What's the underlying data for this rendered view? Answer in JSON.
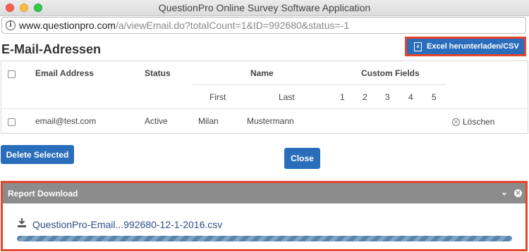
{
  "window": {
    "title": "QuestionPro Online Survey Software Application"
  },
  "address_bar": {
    "host": "www.questionpro.com",
    "path": "/a/viewEmail.do?totalCount=1&ID=992680&status=-1",
    "icon": "info-icon"
  },
  "page": {
    "title": "E-Mail-Adressen",
    "export_button": {
      "label": "Excel herunterladen/CSV",
      "icon": "excel-file-icon",
      "accent": "#2a6ebb",
      "highlight": "#e8442b"
    }
  },
  "table": {
    "headers": {
      "email": "Email Address",
      "status": "Status",
      "name": "Name",
      "custom_fields": "Custom Fields"
    },
    "subheaders": {
      "first": "First",
      "last": "Last",
      "fields": [
        "1",
        "2",
        "3",
        "4",
        "5"
      ]
    },
    "rows": [
      {
        "email": "email@test.com",
        "status": "Active",
        "first": "Milan",
        "last": "Mustermann",
        "action": "Löschen"
      }
    ]
  },
  "buttons": {
    "delete_selected": "Delete Selected",
    "close": "Close"
  },
  "report": {
    "title": "Report Download",
    "filename": "QuestionPro-Email...992680-12-1-2016.csv",
    "progress": 1.0,
    "icons": [
      "chevron-down-icon",
      "close-circle-icon",
      "download-icon"
    ]
  }
}
